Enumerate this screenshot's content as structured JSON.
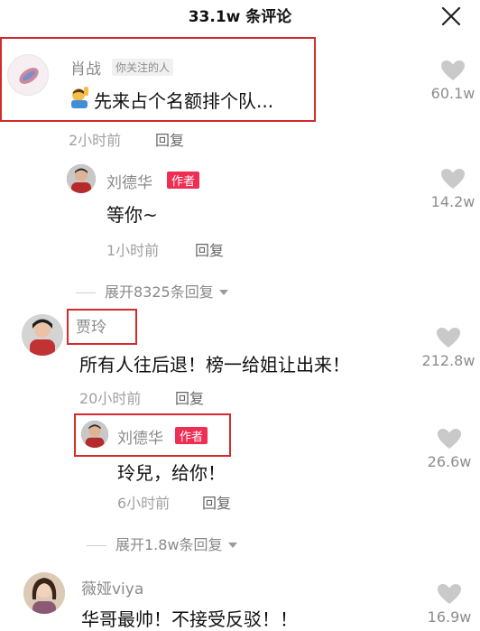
{
  "header": {
    "title": "33.1w 条评论",
    "close_icon": "close-icon"
  },
  "comments": [
    {
      "user": "肖战",
      "tag": "你关注的人",
      "text": "先来占个名额排个队...",
      "emoji": "person-raising-hand-emoji",
      "time": "2小时前",
      "reply_label": "回复",
      "likes": "60.1w",
      "replies": [
        {
          "user": "刘德华",
          "tag": "作者",
          "text": "等你~",
          "time": "1小时前",
          "reply_label": "回复",
          "likes": "14.2w"
        }
      ],
      "expand": "展开8325条回复"
    },
    {
      "user": "贾玲",
      "text": "所有人往后退！榜一给姐让出来！",
      "time": "20小时前",
      "reply_label": "回复",
      "likes": "212.8w",
      "replies": [
        {
          "user": "刘德华",
          "tag": "作者",
          "text": "玲兒，给你！",
          "time": "6小时前",
          "reply_label": "回复",
          "likes": "26.6w"
        }
      ],
      "expand": "展开1.8w条回复"
    },
    {
      "user": "薇娅viya",
      "text": "华哥最帅！不接受反驳！！",
      "likes": "16.9w"
    }
  ],
  "colors": {
    "highlight": "#d42a2a",
    "author_tag": "#ee2e53",
    "heart": "#c9c9c9"
  }
}
